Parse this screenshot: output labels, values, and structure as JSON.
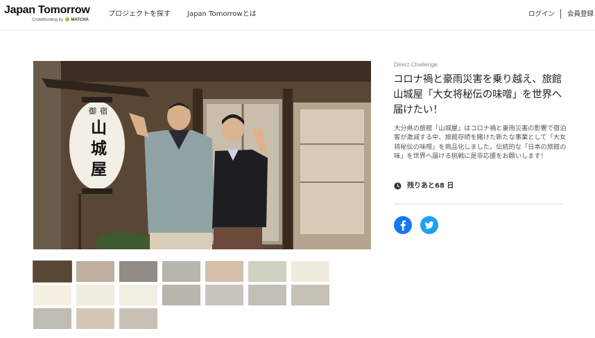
{
  "header": {
    "logo_main": "Japan Tomorrow",
    "logo_sub_prefix": "Crowdfunding by",
    "logo_sub_brand": "MATCHA",
    "nav": [
      {
        "label": "プロジェクトを探す"
      },
      {
        "label": "Japan Tomorrowとは"
      }
    ],
    "login": "ログイン",
    "register": "会員登録"
  },
  "project": {
    "category": "Direct Challenge",
    "title": "コロナ禍と豪雨災害を乗り越え、旅館山城屋「大女将秘伝の味噌」を世界へ届けたい！",
    "description": "大分県の旅館「山城屋」はコロナ禍と豪雨災害の影響で宿泊客が激減する中、旅館存続を賭けた新たな事業として「大女将秘伝の味噌」を商品化しました。伝統的な「日本の旅館の味」を世界へ届ける挑戦に是非応援をお願いします！",
    "remaining": "残りあと68 日",
    "lantern_text": "山城屋",
    "lantern_small": "御 宿"
  },
  "gallery": {
    "thumbnail_count": 17
  },
  "colors": {
    "facebook": "#1877f2",
    "twitter": "#1da1f2",
    "matcha_green": "#8cc63f"
  },
  "icons": {
    "clock": "clock-icon",
    "facebook": "facebook-icon",
    "twitter": "twitter-icon"
  }
}
